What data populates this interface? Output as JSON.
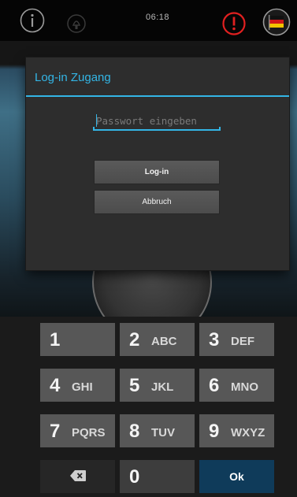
{
  "status_bar": {
    "time": "06:18"
  },
  "icons": {
    "info": "info-icon",
    "lamp": "lamp-icon",
    "alert": "alert-icon",
    "language": "german-flag-icon"
  },
  "colors": {
    "accent": "#33b5e5",
    "alert": "#e02020",
    "dialog_bg": "#2d2d2d",
    "key_bg": "#575757",
    "ok_bg": "#0f3b5a"
  },
  "dialog": {
    "title": "Log-in Zugang",
    "password_placeholder": "Passwort eingeben",
    "password_value": "",
    "login_label": "Log-in",
    "cancel_label": "Abbruch"
  },
  "keypad": {
    "keys": [
      {
        "num": "1",
        "letters": ""
      },
      {
        "num": "2",
        "letters": "ABC"
      },
      {
        "num": "3",
        "letters": "DEF"
      },
      {
        "num": "4",
        "letters": "GHI"
      },
      {
        "num": "5",
        "letters": "JKL"
      },
      {
        "num": "6",
        "letters": "MNO"
      },
      {
        "num": "7",
        "letters": "PQRS"
      },
      {
        "num": "8",
        "letters": "TUV"
      },
      {
        "num": "9",
        "letters": "WXYZ"
      }
    ],
    "zero": "0",
    "ok_label": "Ok",
    "delete_icon": "backspace-icon"
  }
}
